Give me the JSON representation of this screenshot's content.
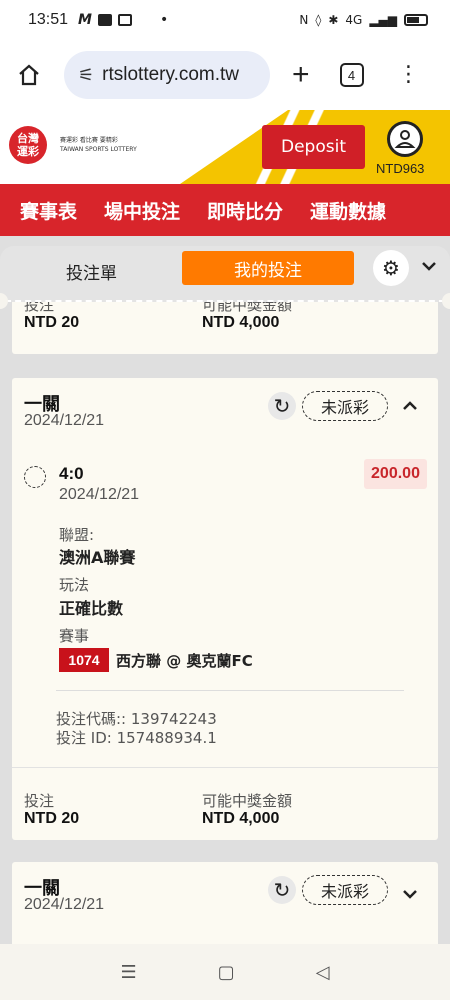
{
  "status_bar": {
    "time": "13:51",
    "network": "4G"
  },
  "browser": {
    "url": "rtslottery.com.tw",
    "tab_count": "4"
  },
  "site": {
    "logo_text_1": "台灣",
    "logo_text_2": "運彩",
    "logo_small": "賽運彩 看比賽 要精彩\nTAIWAN SPORTS LOTTERY",
    "deposit_label": "Deposit",
    "balance": "NTD963"
  },
  "nav": {
    "items": [
      "賽事表",
      "場中投注",
      "即時比分",
      "運動數據"
    ]
  },
  "panel": {
    "tab_betslip": "投注單",
    "tab_mybets": "我的投注"
  },
  "prev_card": {
    "stake_label": "投注",
    "payout_label": "可能中獎金額",
    "stake": "NTD 20",
    "payout": "NTD 4,000"
  },
  "ticket1": {
    "title": "一關",
    "date": "2024/12/21",
    "status": "未派彩",
    "selection": "4:0",
    "selection_date": "2024/12/21",
    "odds": "200.00",
    "league_label": "聯盟:",
    "league": "澳洲A聯賽",
    "market_label": "玩法",
    "market": "正確比數",
    "event_label": "賽事",
    "event_code": "1074",
    "event": "西方聯 @ 奧克蘭FC",
    "bet_code": "投注代碼:: 139742243",
    "bet_id": "投注 ID: 157488934.1",
    "stake_label": "投注",
    "payout_label": "可能中獎金額",
    "stake": "NTD 20",
    "payout": "NTD 4,000"
  },
  "ticket2": {
    "title": "一關",
    "date": "2024/12/21",
    "status": "未派彩"
  }
}
